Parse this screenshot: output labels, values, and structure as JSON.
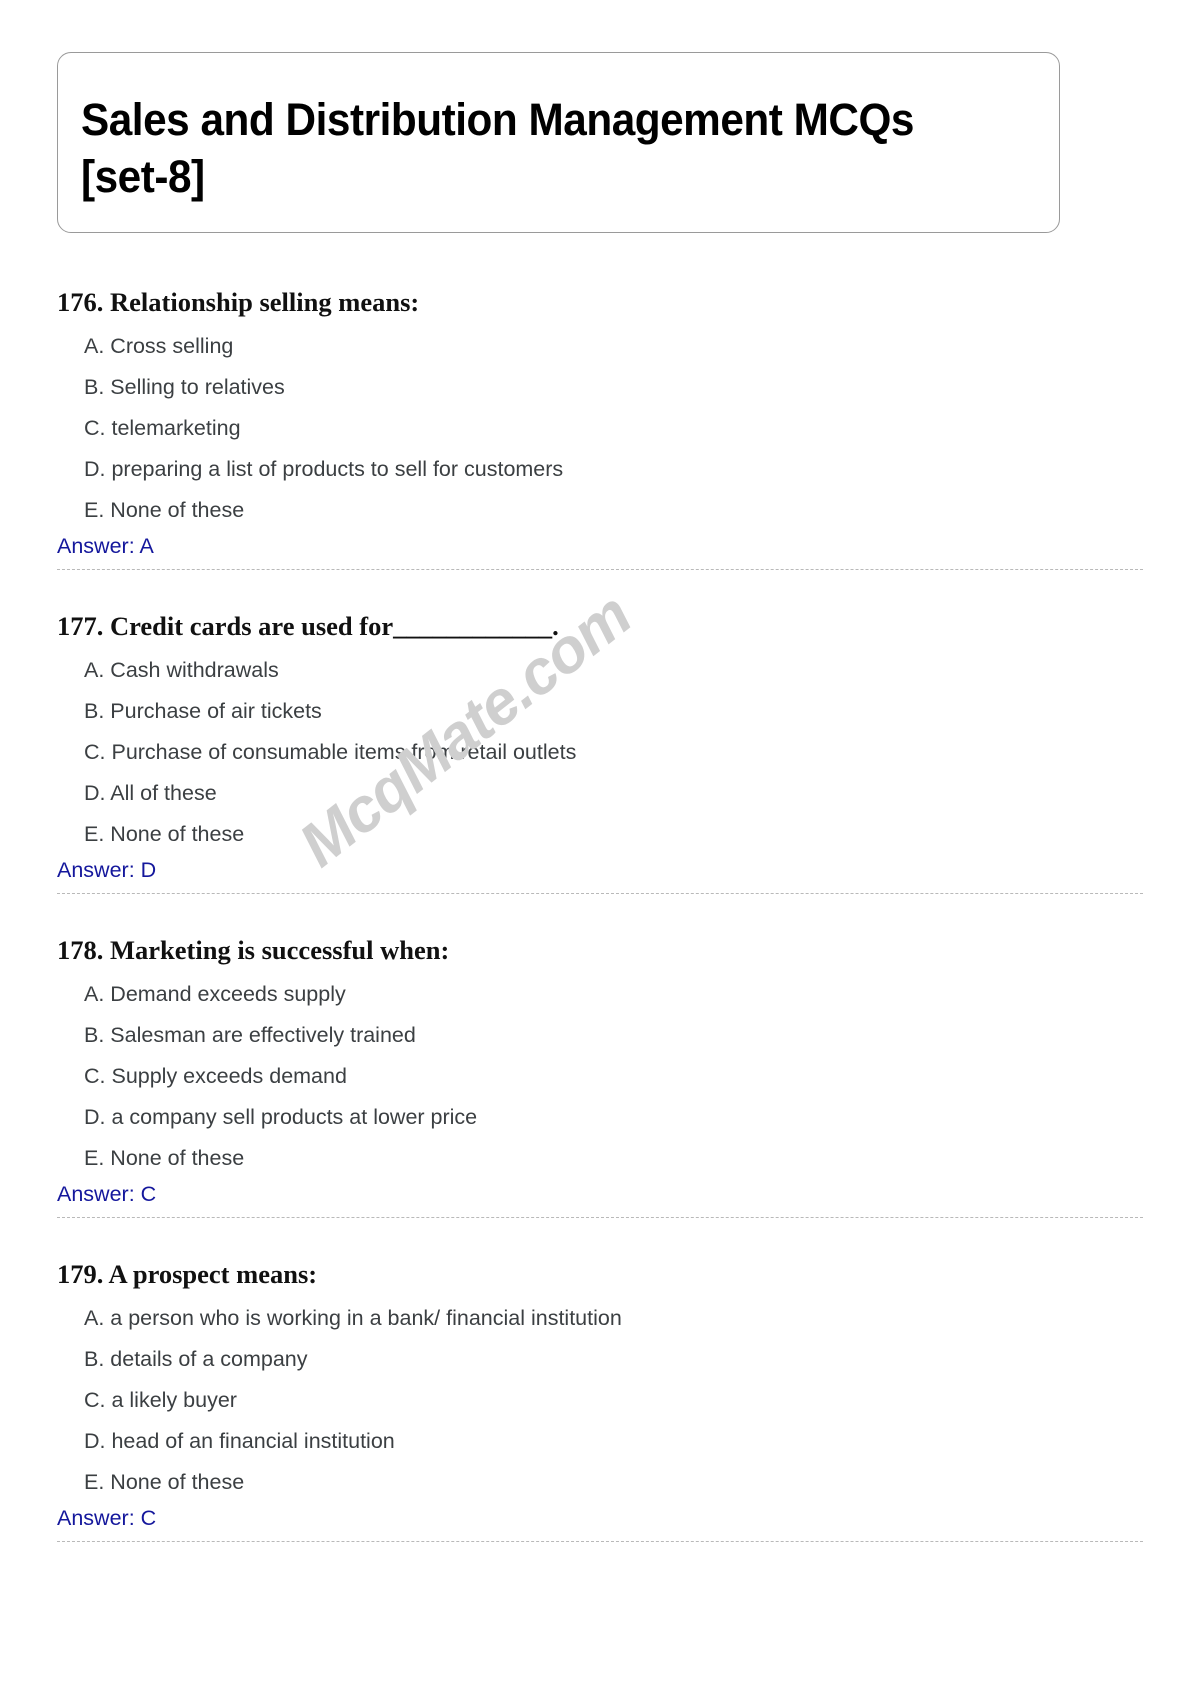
{
  "document": {
    "title": "Sales and Distribution Management MCQs [set-8]",
    "watermark": "McqMate.com",
    "answer_color": "#14179c",
    "watermark_color": "#cfcfcf",
    "divider_color": "#b9b9b9"
  },
  "questions": [
    {
      "title": "176. Relationship selling means:",
      "options": [
        "A. Cross selling",
        "B. Selling to relatives",
        "C. telemarketing",
        "D. preparing a list of products to sell for customers",
        "E. None of these"
      ],
      "answer": "Answer: A"
    },
    {
      "title": "177. Credit cards are used for____________.",
      "options": [
        "A. Cash withdrawals",
        "B. Purchase of air tickets",
        "C. Purchase of consumable items from retail outlets",
        "D. All of these",
        "E. None of these"
      ],
      "answer": "Answer: D"
    },
    {
      "title": "178. Marketing is successful when:",
      "options": [
        "A. Demand exceeds supply",
        "B. Salesman are effectively trained",
        "C. Supply exceeds demand",
        "D. a company sell products at lower price",
        "E. None of these"
      ],
      "answer": "Answer: C"
    },
    {
      "title": "179. A prospect means:",
      "options": [
        "A. a person who is working in a bank/ financial institution",
        "B. details of a company",
        "C. a likely buyer",
        "D. head of an financial institution",
        "E. None of these"
      ],
      "answer": "Answer: C"
    }
  ]
}
